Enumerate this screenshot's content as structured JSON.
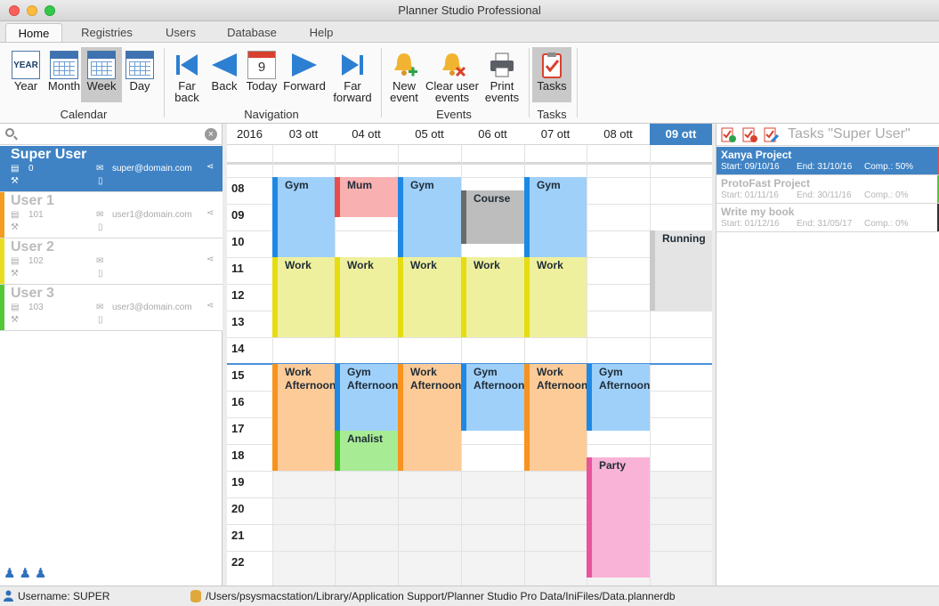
{
  "window": {
    "title": "Planner Studio Professional"
  },
  "tabs": [
    {
      "label": "Home",
      "active": true
    },
    {
      "label": "Registries"
    },
    {
      "label": "Users"
    },
    {
      "label": "Database"
    },
    {
      "label": "Help"
    }
  ],
  "ribbon": {
    "calendar": {
      "group": "Calendar",
      "year": "Year",
      "month": "Month",
      "week": "Week",
      "day": "Day",
      "year_icon_text": "YEAR",
      "selected": "Week"
    },
    "navigation": {
      "group": "Navigation",
      "far_back": "Far\nback",
      "back": "Back",
      "today": "Today",
      "today_icon_text": "9",
      "forward": "Forward",
      "far_forward": "Far\nforward"
    },
    "events": {
      "group": "Events",
      "new_event": "New\nevent",
      "clear": "Clear user\nevents",
      "print": "Print\nevents"
    },
    "tasks": {
      "group": "Tasks",
      "tasks": "Tasks"
    }
  },
  "users": [
    {
      "name": "Super User",
      "id": "0",
      "email": "super@domain.com",
      "color": "#3f83c5",
      "selected": true
    },
    {
      "name": "User 1",
      "id": "101",
      "email": "user1@domain.com",
      "color": "#f39c21"
    },
    {
      "name": "User 2",
      "id": "102",
      "email": "",
      "color": "#e8de1f"
    },
    {
      "name": "User 3",
      "id": "103",
      "email": "user3@domain.com",
      "color": "#55c638"
    }
  ],
  "calendar": {
    "year": "2016",
    "days": [
      "03 ott",
      "04 ott",
      "05 ott",
      "06 ott",
      "07 ott",
      "08 ott",
      "09 ott"
    ],
    "today": "09 ott",
    "hours": [
      "08",
      "09",
      "10",
      "11",
      "12",
      "13",
      "14",
      "15",
      "16",
      "17",
      "18",
      "19",
      "20",
      "21",
      "22"
    ],
    "events": [
      {
        "day": 0,
        "start": 8,
        "end": 11,
        "title": "Gym",
        "bg": "#9fd0f9",
        "strip": "#1e88e5"
      },
      {
        "day": 0,
        "start": 11,
        "end": 14,
        "title": "Work",
        "bg": "#eff09e",
        "strip": "#e6dc12"
      },
      {
        "day": 0,
        "start": 15,
        "end": 19,
        "title": "Work\nAfternoon",
        "bg": "#fdcb98",
        "strip": "#f7931e"
      },
      {
        "day": 1,
        "start": 8,
        "end": 9.5,
        "title": "Mum",
        "bg": "#f9b0b0",
        "strip": "#e84c4c"
      },
      {
        "day": 1,
        "start": 11,
        "end": 14,
        "title": "Work",
        "bg": "#eff09e",
        "strip": "#e6dc12"
      },
      {
        "day": 1,
        "start": 15,
        "end": 17.5,
        "title": "Gym\nAfternoon",
        "bg": "#9fd0f9",
        "strip": "#1e88e5"
      },
      {
        "day": 1,
        "start": 17.5,
        "end": 19,
        "title": "Analist",
        "bg": "#a8eb95",
        "strip": "#3cc31c"
      },
      {
        "day": 2,
        "start": 8,
        "end": 11,
        "title": "Gym",
        "bg": "#9fd0f9",
        "strip": "#1e88e5"
      },
      {
        "day": 2,
        "start": 11,
        "end": 14,
        "title": "Work",
        "bg": "#eff09e",
        "strip": "#e6dc12"
      },
      {
        "day": 2,
        "start": 15,
        "end": 19,
        "title": "Work\nAfternoon",
        "bg": "#fdcb98",
        "strip": "#f7931e"
      },
      {
        "day": 3,
        "start": 8.5,
        "end": 10.5,
        "title": "Course",
        "bg": "#bdbdbd",
        "strip": "#6a6a6a"
      },
      {
        "day": 3,
        "start": 11,
        "end": 14,
        "title": "Work",
        "bg": "#eff09e",
        "strip": "#e6dc12"
      },
      {
        "day": 3,
        "start": 15,
        "end": 17.5,
        "title": "Gym\nAfternoon",
        "bg": "#9fd0f9",
        "strip": "#1e88e5"
      },
      {
        "day": 4,
        "start": 8,
        "end": 11,
        "title": "Gym",
        "bg": "#9fd0f9",
        "strip": "#1e88e5"
      },
      {
        "day": 4,
        "start": 11,
        "end": 14,
        "title": "Work",
        "bg": "#eff09e",
        "strip": "#e6dc12"
      },
      {
        "day": 4,
        "start": 15,
        "end": 19,
        "title": "Work\nAfternoon",
        "bg": "#fdcb98",
        "strip": "#f7931e"
      },
      {
        "day": 5,
        "start": 15,
        "end": 17.5,
        "title": "Gym\nAfternoon",
        "bg": "#9fd0f9",
        "strip": "#1e88e5"
      },
      {
        "day": 5,
        "start": 18.5,
        "end": 23,
        "title": "Party",
        "bg": "#f9b3d6",
        "strip": "#e7559c"
      },
      {
        "day": 6,
        "start": 10,
        "end": 13,
        "title": "Running",
        "bg": "#e4e4e4",
        "strip": "#c9c9c9"
      }
    ]
  },
  "tasks_panel": {
    "title": "Tasks \"Super User\"",
    "tasks": [
      {
        "name": "Xanya Project",
        "start": "Start: 09/10/16",
        "end": "End: 31/10/16",
        "comp": "Comp.: 50%",
        "selected": true,
        "color": "#e84c4c"
      },
      {
        "name": "ProtoFast Project",
        "start": "Start: 01/11/16",
        "end": "End: 30/11/16",
        "comp": "Comp.: 0%",
        "color": "#55c638"
      },
      {
        "name": "Write my book",
        "start": "Start: 01/12/16",
        "end": "End: 31/05/17",
        "comp": "Comp.: 0%",
        "color": "#333333"
      }
    ]
  },
  "status": {
    "username": "Username: SUPER",
    "path": "/Users/psysmacstation/Library/Application Support/Planner Studio Pro Data/IniFiles/Data.plannerdb"
  }
}
